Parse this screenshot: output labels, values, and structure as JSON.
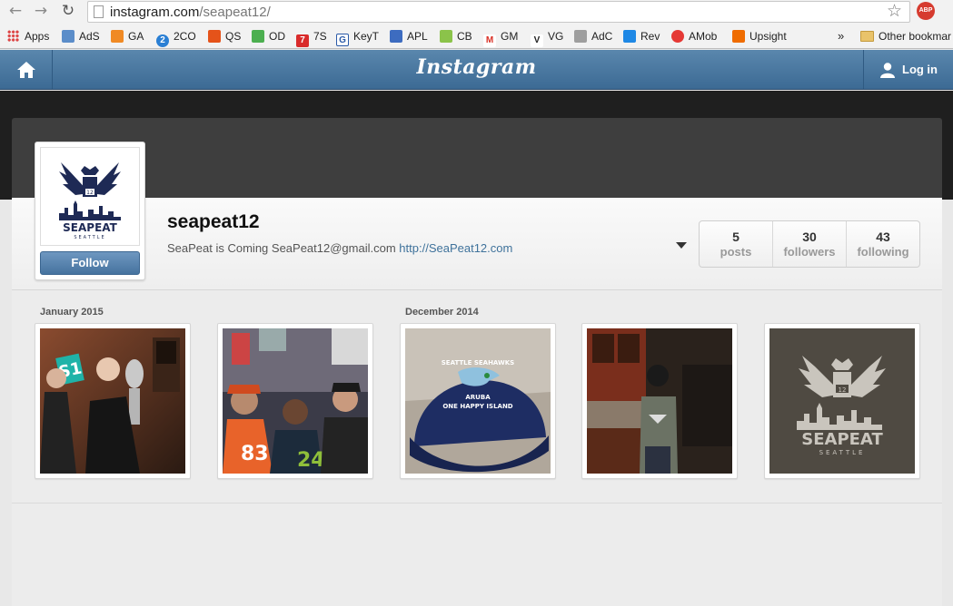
{
  "browser": {
    "url_domain": "instagram.com",
    "url_path": "/seapeat12/",
    "abp_label": "ABP",
    "bookmarks": [
      {
        "label": "Apps"
      },
      {
        "label": "AdS"
      },
      {
        "label": "GA"
      },
      {
        "label": "2CO",
        "icon": "2"
      },
      {
        "label": "QS"
      },
      {
        "label": "OD"
      },
      {
        "label": "7S",
        "icon": "7"
      },
      {
        "label": "KeyT",
        "icon": "G"
      },
      {
        "label": "APL"
      },
      {
        "label": "CB"
      },
      {
        "label": "GM",
        "icon": "M"
      },
      {
        "label": "VG",
        "icon": "V"
      },
      {
        "label": "AdC"
      },
      {
        "label": "Rev"
      },
      {
        "label": "AMob"
      },
      {
        "label": "Upsight"
      }
    ],
    "overflow": "»",
    "other_bookmarks": "Other bookmar"
  },
  "header": {
    "brand": "Instagram",
    "login": "Log in"
  },
  "profile": {
    "username": "seapeat12",
    "bio_text": "SeaPeat is Coming SeaPeat12@gmail.com",
    "bio_link": "http://SeaPeat12.com",
    "follow_label": "Follow",
    "logo_text": "SEAPEAT",
    "logo_sub": "SEATTLE",
    "logo_num": "12",
    "stats": [
      {
        "num": "5",
        "label": "posts"
      },
      {
        "num": "30",
        "label": "followers"
      },
      {
        "num": "43",
        "label": "following"
      }
    ]
  },
  "feed": {
    "months": [
      "January 2015",
      "December 2014"
    ],
    "photo3": {
      "line1": "SEATTLE SEAHAWKS",
      "line2": "ARUBA",
      "line3": "ONE HAPPY ISLAND"
    },
    "photo1_sign": "S1",
    "photo5": {
      "text": "SEAPEAT",
      "sub": "SEATTLE",
      "num": "12"
    }
  },
  "colors": {
    "ig_blue": "#3f729b",
    "abp_red": "#d63b2f"
  }
}
